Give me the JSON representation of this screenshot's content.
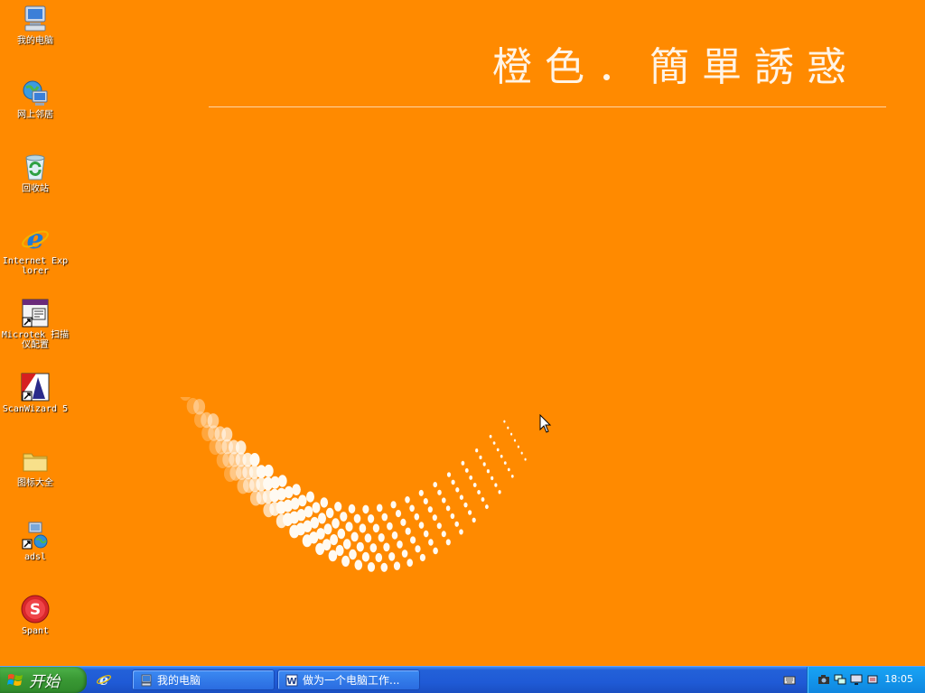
{
  "wallpaper": {
    "title": "橙色．簡單誘惑"
  },
  "desktop_icons": [
    {
      "label": "我的电脑",
      "icon": "my-computer-icon"
    },
    {
      "label": "网上邻居",
      "icon": "network-places-icon"
    },
    {
      "label": "回收站",
      "icon": "recycle-bin-icon"
    },
    {
      "label": "Internet Explorer",
      "icon": "internet-explorer-icon"
    },
    {
      "label": "Microtek 扫描仪配置",
      "icon": "scanner-config-shortcut-icon"
    },
    {
      "label": "ScanWizard 5",
      "icon": "scanwizard-shortcut-icon"
    },
    {
      "label": "图标大全",
      "icon": "folder-icon"
    },
    {
      "label": "adsl",
      "icon": "network-connection-shortcut-icon"
    },
    {
      "label": "Spant",
      "icon": "spant-app-icon"
    }
  ],
  "taskbar": {
    "start_label": "开始",
    "tasks": [
      {
        "label": "我的电脑",
        "icon": "my-computer-icon"
      },
      {
        "label": "做为一个电脑工作...",
        "icon": "word-document-icon"
      }
    ],
    "clock": "18:05"
  },
  "colors": {
    "desktop_bg": "#ff8a00",
    "taskbar_blue": "#2361d8",
    "start_green": "#3a9a35",
    "tray_blue": "#0f87e0"
  }
}
